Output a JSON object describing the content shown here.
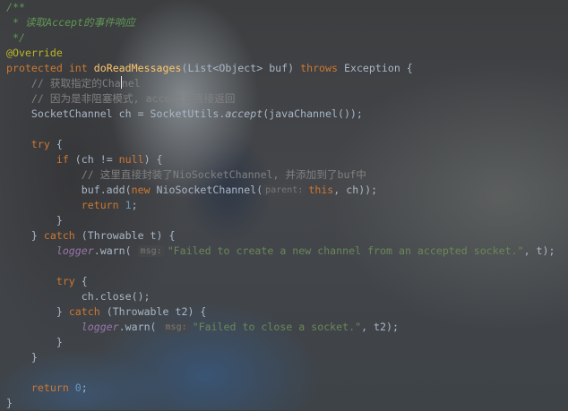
{
  "editor": {
    "line1": "/**",
    "line2": " * 读取Accept的事件响应",
    "line3": " */",
    "line4": "@Override",
    "line5": {
      "kw1": "protected",
      "kw2": "int",
      "method": "doReadMessages",
      "params": "(List<Object> buf) ",
      "kw3": "throws",
      "rest": " Exception {"
    },
    "line6": {
      "a": "    // 获取指定的Cha",
      "b": "nel"
    },
    "line7": "    // 因为是非阻塞模式, accept会直接返回",
    "line8": {
      "a": "    SocketChannel ch = SocketUtils.",
      "b": "accept",
      "c": "(javaChannel());"
    },
    "line9": {
      "kw": "    try",
      "rest": " {"
    },
    "line10": {
      "a": "        ",
      "kw": "if",
      "b": " (ch != ",
      "kw2": "null",
      "c": ") {"
    },
    "line11": "            // 这里直接封装了NioSocketChannel, 并添加到了buf中",
    "line12": {
      "a": "            buf.add(",
      "kw": "new",
      "b": " NioSocketChannel(",
      "hint": "parent:",
      "kw2": "this",
      "c": ", ch));"
    },
    "line13": {
      "kw": "            return",
      "num": "1",
      "c": ";"
    },
    "line14": "        }",
    "line15": {
      "a": "    } ",
      "kw": "catch",
      "b": " (Throwable t) {"
    },
    "line16": {
      "a": "        ",
      "field": "logger",
      "b": ".warn(",
      "hint": "msg:",
      "str": "\"Failed to create a new channel from an accepted socket.\"",
      "c": ", t);"
    },
    "line17": {
      "kw": "        try",
      "rest": " {"
    },
    "line18": "            ch.close();",
    "line19": {
      "a": "        } ",
      "kw": "catch",
      "b": " (Throwable t2) {"
    },
    "line20": {
      "a": "            ",
      "field": "logger",
      "b": ".warn(",
      "hint": "msg:",
      "str": "\"Failed to close a socket.\"",
      "c": ", t2);"
    },
    "line21": "        }",
    "line22": "    }",
    "line23": {
      "kw": "    return",
      "num": "0",
      "c": ";"
    },
    "line24": "}"
  },
  "colors": {
    "keyword": "#cc7832",
    "number": "#6897bb",
    "string": "#6a8759",
    "comment": "#808080",
    "doc_comment": "#629755",
    "annotation": "#bbb529",
    "method_decl": "#ffc66d",
    "field": "#9876aa",
    "default_text": "#a9b7c6"
  }
}
